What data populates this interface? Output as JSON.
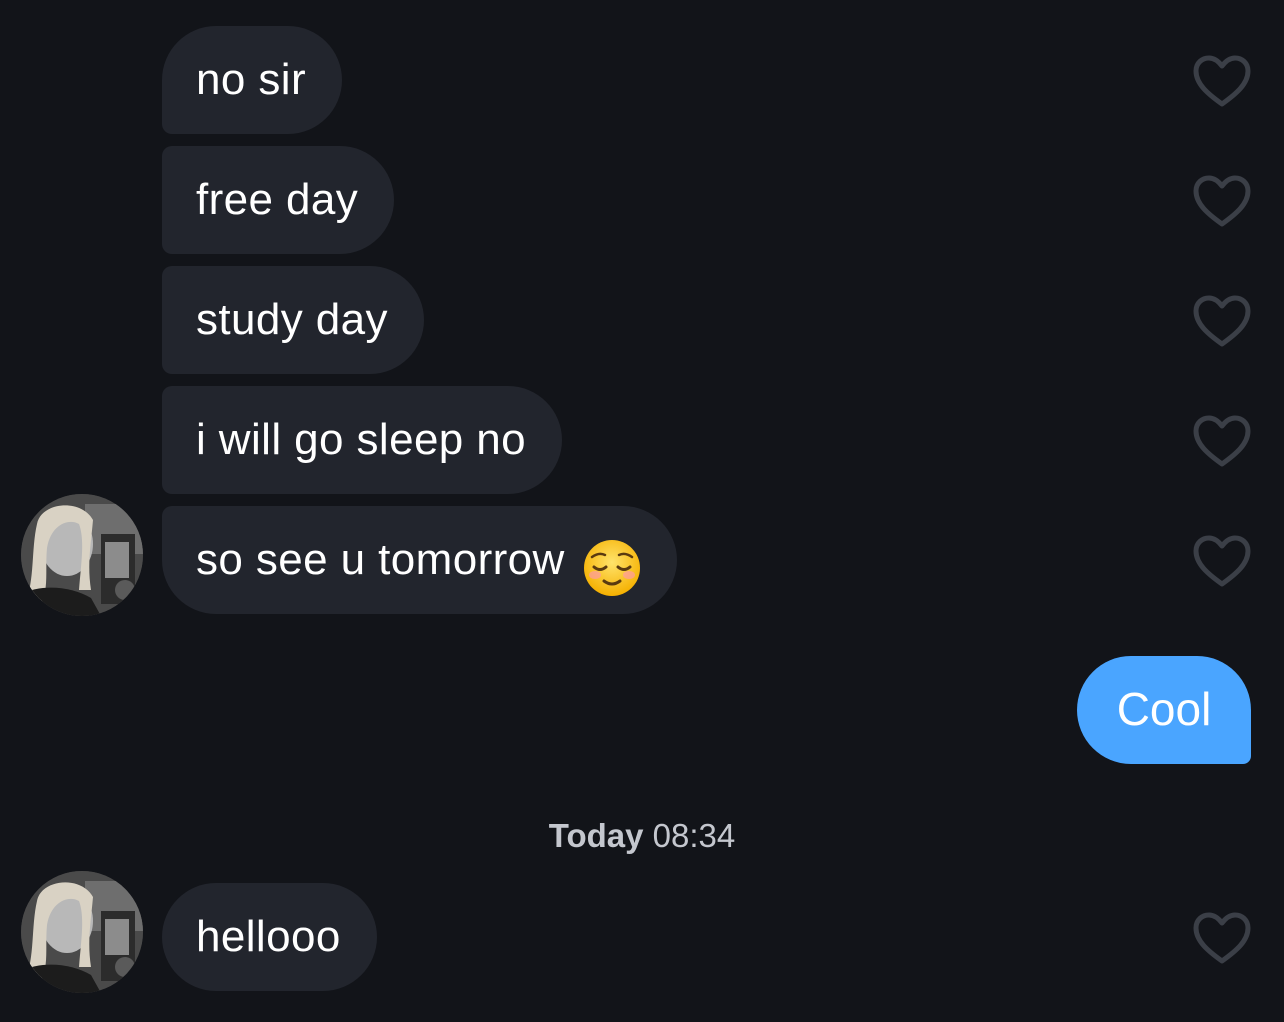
{
  "messages_received_group_1": [
    {
      "text": "no sir"
    },
    {
      "text": "free day"
    },
    {
      "text": "study day"
    },
    {
      "text": "i will go sleep no"
    },
    {
      "text": "so see u tomorrow",
      "emoji": "relieved-face-emoji"
    }
  ],
  "message_sent": {
    "text": "Cool"
  },
  "timestamp": {
    "day": "Today",
    "time": "08:34"
  },
  "messages_received_group_2": [
    {
      "text": "hellooo"
    }
  ],
  "icons": {
    "like": "heart-outline-icon",
    "avatar": "contact-avatar"
  },
  "colors": {
    "background": "#121419",
    "received_bubble": "#22252d",
    "sent_bubble": "#4aa5ff",
    "heart_stroke": "#3b3f47",
    "timestamp_text": "#c4c7ce"
  }
}
